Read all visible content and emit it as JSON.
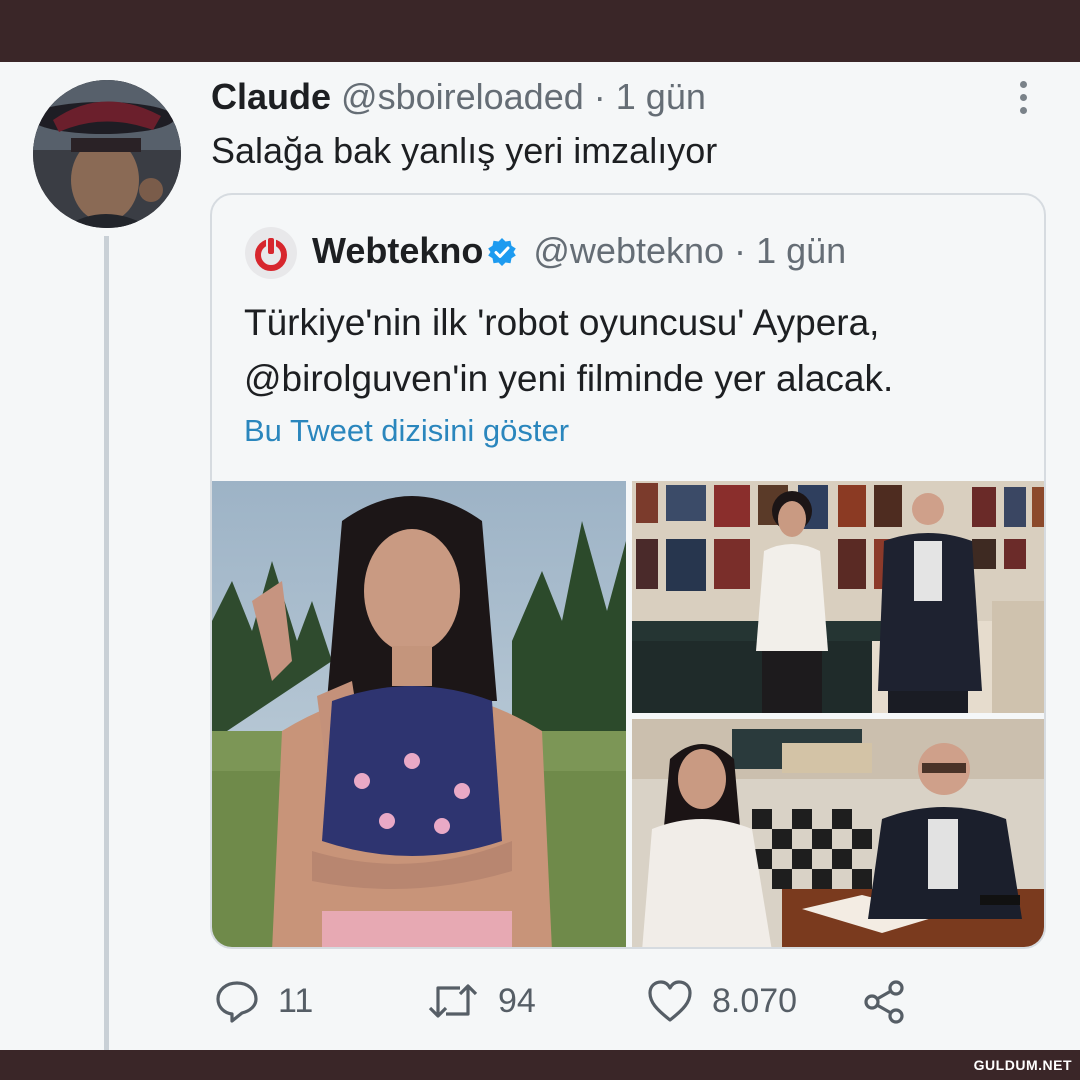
{
  "tweet": {
    "display_name": "Claude",
    "handle": "@sboireloaded",
    "separator": "·",
    "time": "1 gün",
    "text": "Salağa bak yanlış yeri imzalıyor"
  },
  "quoted": {
    "display_name": "Webtekno",
    "handle": "@webtekno",
    "separator": "·",
    "time": "1 gün",
    "text": "Türkiye'nin ilk 'robot oyuncusu' Aypera, @birolguven'in yeni filminde yer alacak.",
    "thread_link": "Bu Tweet dizisini göster"
  },
  "actions": {
    "reply_count": "11",
    "retweet_count": "94",
    "like_count": "8.070"
  },
  "watermark": "GULDUM.NET",
  "icons": {
    "menu": "more-vertical-icon",
    "verified": "verified-badge-icon",
    "reply": "reply-icon",
    "retweet": "retweet-icon",
    "like": "heart-icon",
    "share": "share-icon",
    "logo": "power-logo-icon"
  },
  "colors": {
    "link": "#2a86bd",
    "verified": "#1d9bf0",
    "logo_red": "#d7262d",
    "frame": "#3a2628"
  }
}
